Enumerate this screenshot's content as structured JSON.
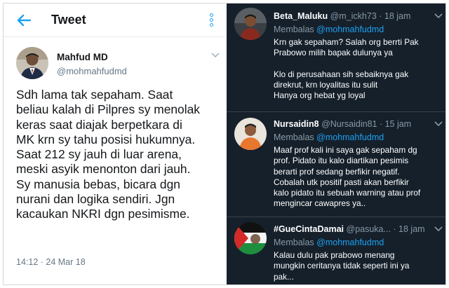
{
  "header": {
    "title": "Tweet",
    "back_icon": "arrow-left-icon",
    "menu_icon": "kebab-vertical-icon",
    "accent": "#1da1f2"
  },
  "main_tweet": {
    "author_name": "Mahfud MD",
    "author_handle": "@mohmahfudmd",
    "lines": [
      "Sdh lama tak sepaham. Saat",
      "beliau kalah di Pilpres sy menolak",
      "keras saat diajak  berpetkara di",
      "MK krn sy tahu posisi hukumnya.",
      "Saat 212 sy jauh di luar arena,",
      "meski asyik menonton dari jauh.",
      "Sy manusia bebas, bicara dgn",
      "nurani dan logika sendiri. Jgn",
      "kacaukan NKRI dgn pesimisme."
    ],
    "time": "14:12 · 24 Mar 18"
  },
  "replies": [
    {
      "name": "Beta_Maluku",
      "meta": "@m_ickh73 · 18 jam",
      "replying_prefix": "Membalas ",
      "replying_to": "@mohmahfudmd",
      "lines": [
        "Krn gak sepaham?  Salah org berrti Pak",
        "Prabowo milih bapak dulunya ya",
        "",
        "Klo di perusahaan sih sebaiknya gak",
        "direkrut, krn loyalitas itu sulit",
        "Hanya org hebat yg loyal"
      ]
    },
    {
      "name": "Nursaidin8",
      "meta": "@Nursaidin81 · 15 jam",
      "replying_prefix": "Membalas ",
      "replying_to": "@mohmahfudmd",
      "lines": [
        "Maaf prof kali ini saya gak sepaham dg",
        "prof. Pidato itu kalo diartikan pesimis",
        "berarti prof sedang berfikir negatif.",
        "Cobalah utk positif pasti akan berfikir",
        "kalo pidato itu sebuah warning atau prof",
        "mengincar cawapres ya.."
      ]
    },
    {
      "name": "#GueCintaDamai",
      "meta": "@pasuka... · 18 jam",
      "replying_prefix": "Membalas ",
      "replying_to": "@mohmahfudmd",
      "lines": [
        "Kalau dulu pak prabowo menang",
        "mungkin ceritanya tidak seperti ini ya",
        "pak..."
      ]
    }
  ],
  "colors": {
    "dark_bg": "#15202b",
    "muted": "#8899a6",
    "light_muted": "#657786",
    "divider": "#38444d"
  }
}
